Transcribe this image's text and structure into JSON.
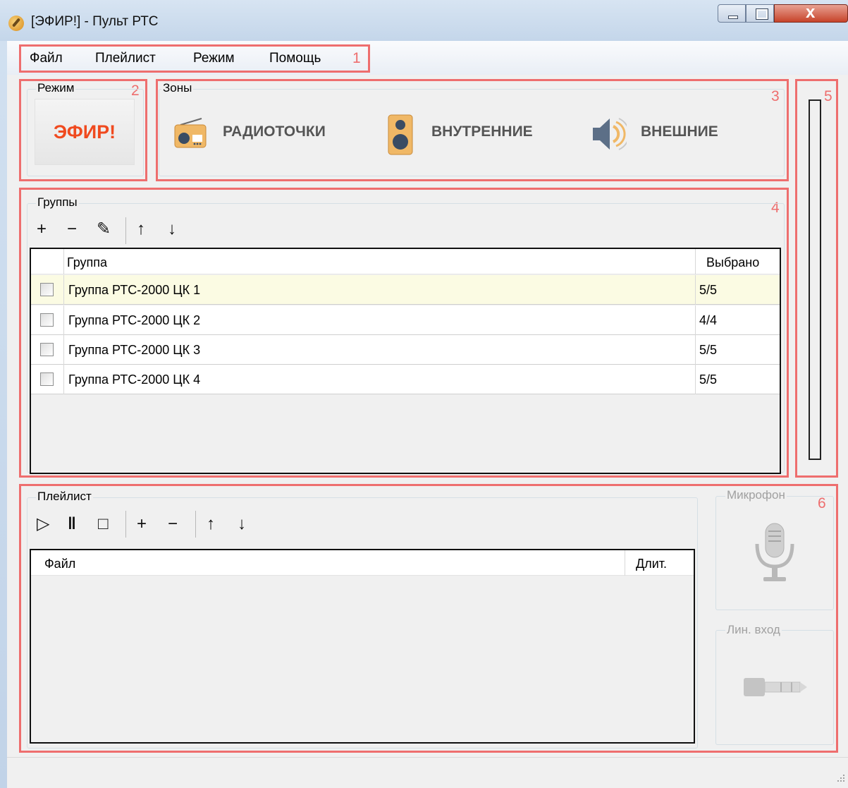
{
  "window": {
    "title": "[ЭФИР!] - Пульт РТС"
  },
  "menu": {
    "items": [
      {
        "label": "Файл"
      },
      {
        "label": "Плейлист"
      },
      {
        "label": "Режим"
      },
      {
        "label": "Помощь"
      }
    ]
  },
  "annotations": [
    "1",
    "2",
    "3",
    "4",
    "5",
    "6"
  ],
  "mode": {
    "group_label": "Режим",
    "button_label": "ЭФИР!"
  },
  "zones": {
    "group_label": "Зоны",
    "items": [
      {
        "label": "РАДИОТОЧКИ",
        "icon": "radio-icon"
      },
      {
        "label": "ВНУТРЕННИЕ",
        "icon": "speaker-icon"
      },
      {
        "label": "ВНЕШНИЕ",
        "icon": "loudspeaker-icon"
      }
    ]
  },
  "groups": {
    "group_label": "Группы",
    "toolbar": {
      "add": "+",
      "remove": "−",
      "edit": "✎",
      "up": "↑",
      "down": "↓"
    },
    "columns": [
      "Группа",
      "Выбрано"
    ],
    "rows": [
      {
        "name": "Группа РТС-2000 ЦК 1",
        "selected": "5/5"
      },
      {
        "name": "Группа РТС-2000 ЦК 2",
        "selected": "4/4"
      },
      {
        "name": "Группа РТС-2000 ЦК 3",
        "selected": "5/5"
      },
      {
        "name": "Группа РТС-2000 ЦК 4",
        "selected": "5/5"
      }
    ]
  },
  "level_meter": {
    "level": 0
  },
  "playlist": {
    "group_label": "Плейлист",
    "toolbar": {
      "play": "▷",
      "pause": "ǁ",
      "stop": "□",
      "add": "+",
      "remove": "−",
      "up": "↑",
      "down": "↓"
    },
    "columns": [
      "Файл",
      "Длит."
    ],
    "rows": []
  },
  "inputs": {
    "microphone_label": "Микрофон",
    "line_in_label": "Лин. вход"
  },
  "colors": {
    "annotation": "#ee6e6e",
    "mode_text": "#f04a1f",
    "selected_row": "#fbfbe3"
  }
}
